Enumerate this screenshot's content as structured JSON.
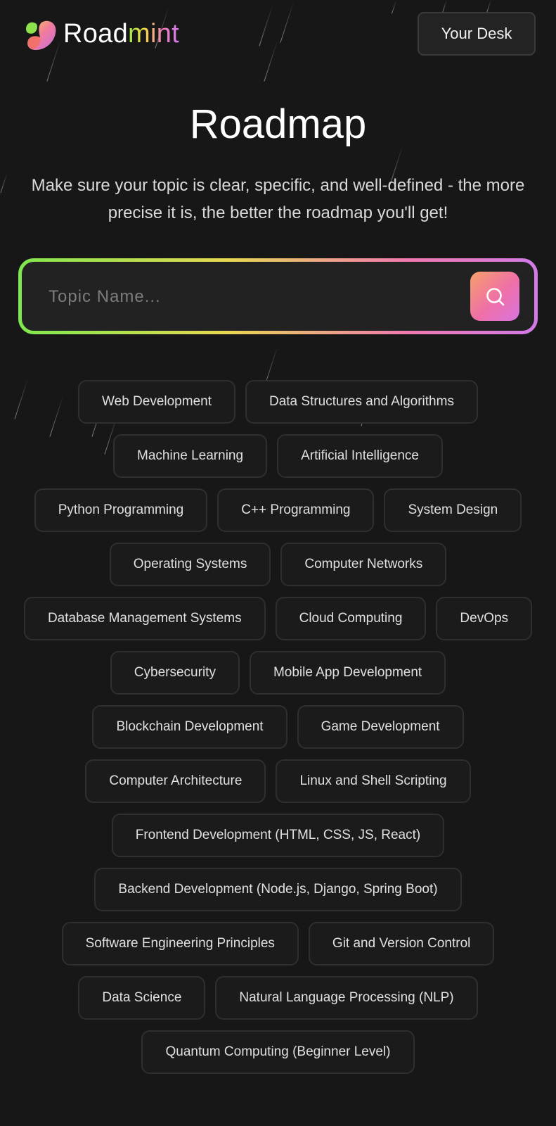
{
  "header": {
    "brand_prefix": "Road",
    "brand_accent": "mint",
    "desk_button": "Your Desk"
  },
  "main": {
    "title": "Roadmap",
    "subtitle": "Make sure your topic is clear, specific, and well-defined - the more precise it is, the better the roadmap you'll get!"
  },
  "search": {
    "placeholder": "Topic Name...",
    "value": "",
    "button_icon": "search-icon"
  },
  "colors": {
    "background": "#171717",
    "gradient": [
      "#7ee84f",
      "#e8d852",
      "#f07ab0",
      "#d27ae8"
    ],
    "chip_border": "#2f2f2f"
  },
  "topics": [
    [
      "Web Development",
      "Data Structures and Algorithms"
    ],
    [
      "Machine Learning",
      "Artificial Intelligence"
    ],
    [
      "Python Programming",
      "C++ Programming",
      "System Design"
    ],
    [
      "Operating Systems",
      "Computer Networks"
    ],
    [
      "Database Management Systems",
      "Cloud Computing",
      "DevOps"
    ],
    [
      "Cybersecurity",
      "Mobile App Development"
    ],
    [
      "Blockchain Development",
      "Game Development"
    ],
    [
      "Computer Architecture",
      "Linux and Shell Scripting"
    ],
    [
      "Frontend Development (HTML, CSS, JS, React)"
    ],
    [
      "Backend Development (Node.js, Django, Spring Boot)"
    ],
    [
      "Software Engineering Principles",
      "Git and Version Control"
    ],
    [
      "Data Science",
      "Natural Language Processing (NLP)"
    ],
    [
      "Quantum Computing (Beginner Level)"
    ]
  ]
}
